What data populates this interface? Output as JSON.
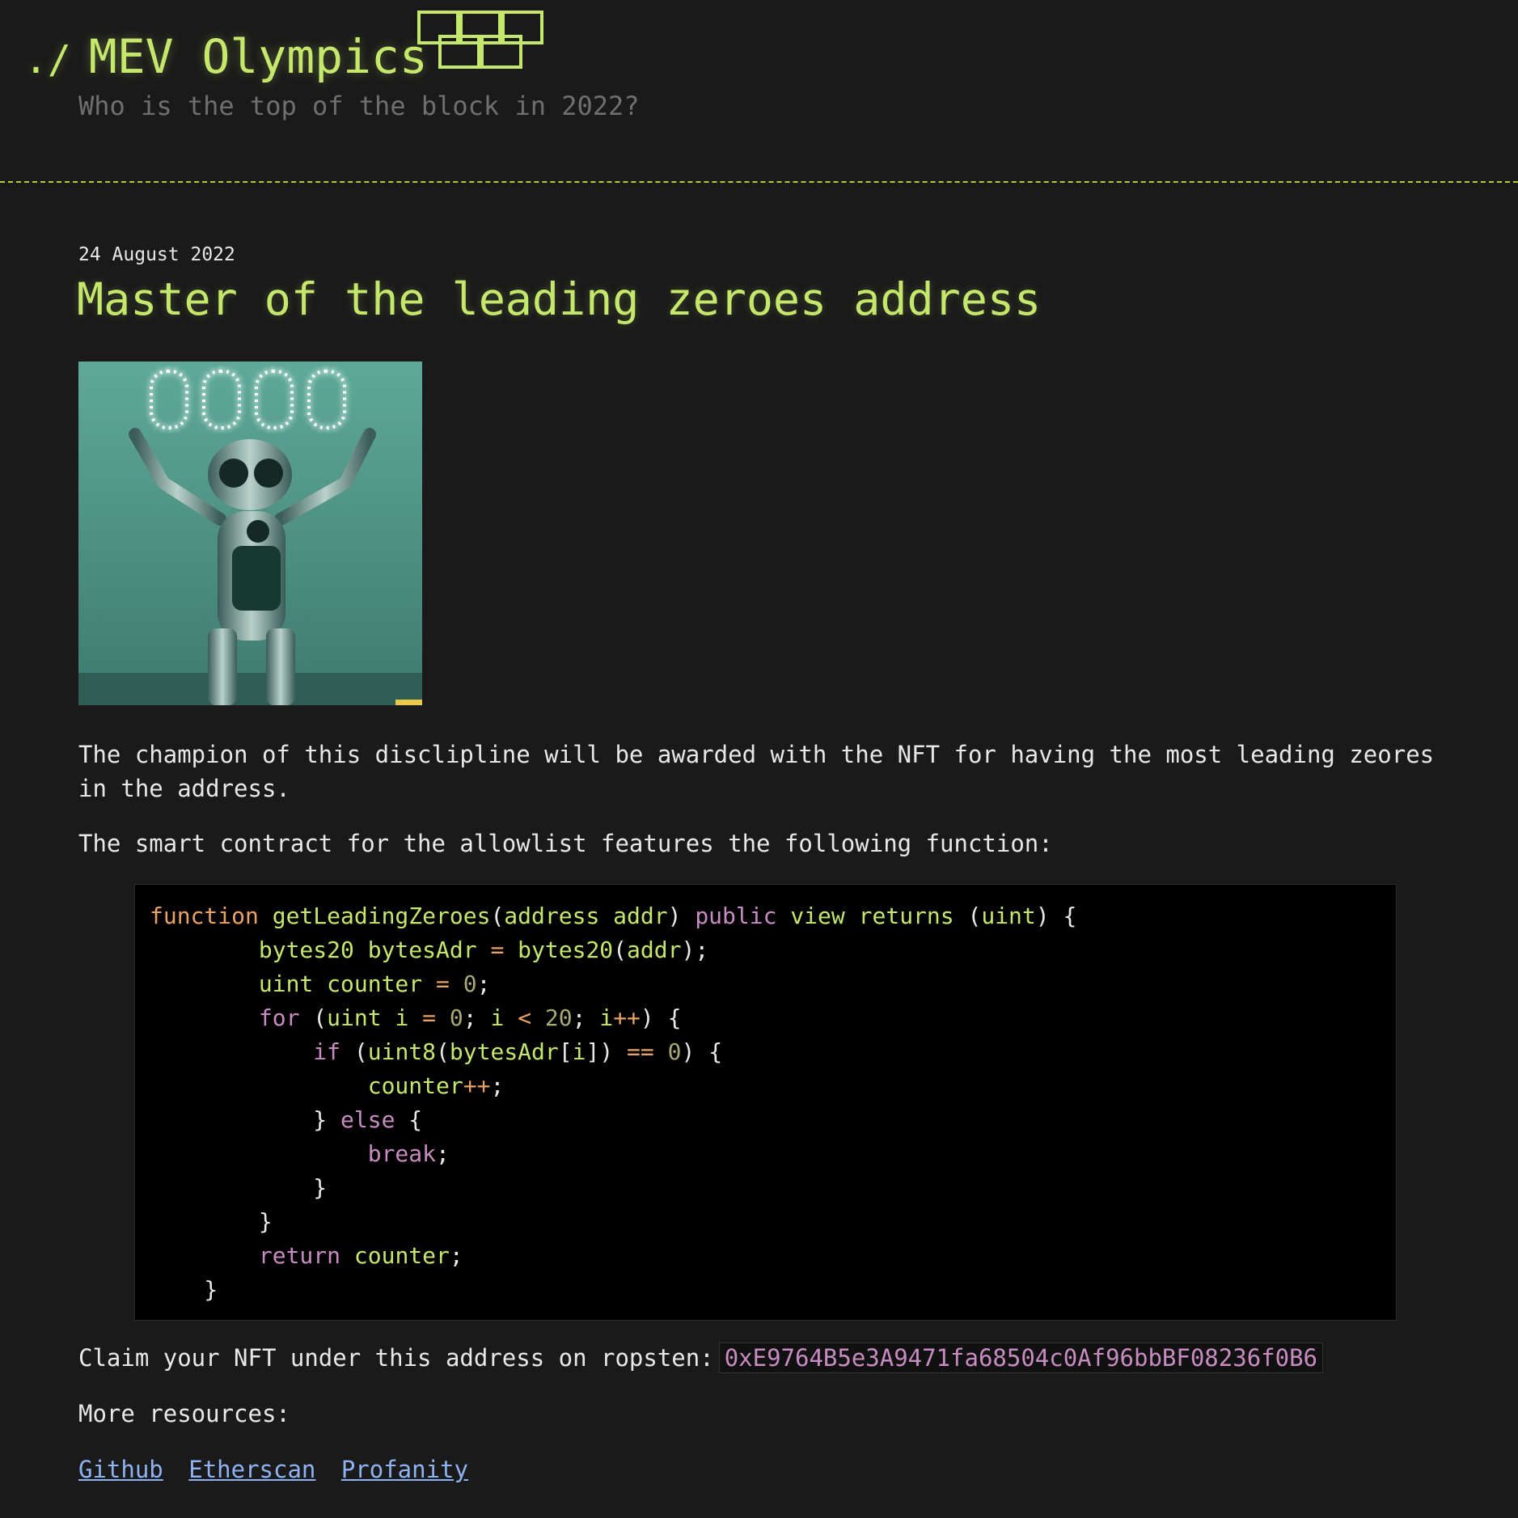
{
  "header": {
    "prompt": "./",
    "site_title": "MEV Olympics",
    "tagline": "Who is the top of the block in 2022?",
    "logo_icon": "olympic-rings-icon"
  },
  "post": {
    "date": "24 August 2022",
    "title": "Master of the leading zeroes address",
    "image_description_icon": "robot-zeroes-image",
    "paragraph_1": "The champion of this disclipline will be awarded with the NFT for having the most leading zeores in the address.",
    "paragraph_2": "The smart contract for the allowlist features the following function:",
    "code_lines": [
      [
        [
          "kw-fn",
          "function"
        ],
        [
          "t",
          " "
        ],
        [
          "id",
          "getLeadingZeroes"
        ],
        [
          "t",
          "("
        ],
        [
          "id",
          "address addr"
        ],
        [
          "t",
          ") "
        ],
        [
          "kw",
          "public"
        ],
        [
          "t",
          " "
        ],
        [
          "id",
          "view returns"
        ],
        [
          "t",
          " ("
        ],
        [
          "id",
          "uint"
        ],
        [
          "t",
          ") {"
        ]
      ],
      [
        [
          "t",
          "        "
        ],
        [
          "id",
          "bytes20 bytesAdr"
        ],
        [
          "t",
          " "
        ],
        [
          "op",
          "="
        ],
        [
          "t",
          " "
        ],
        [
          "id",
          "bytes20"
        ],
        [
          "t",
          "("
        ],
        [
          "id",
          "addr"
        ],
        [
          "t",
          ");"
        ]
      ],
      [
        [
          "t",
          "        "
        ],
        [
          "id",
          "uint counter"
        ],
        [
          "t",
          " "
        ],
        [
          "op",
          "="
        ],
        [
          "t",
          " "
        ],
        [
          "num",
          "0"
        ],
        [
          "t",
          ";"
        ]
      ],
      [
        [
          "t",
          "        "
        ],
        [
          "kw",
          "for"
        ],
        [
          "t",
          " ("
        ],
        [
          "id",
          "uint i"
        ],
        [
          "t",
          " "
        ],
        [
          "op",
          "="
        ],
        [
          "t",
          " "
        ],
        [
          "num",
          "0"
        ],
        [
          "t",
          "; "
        ],
        [
          "id",
          "i"
        ],
        [
          "t",
          " "
        ],
        [
          "op",
          "<"
        ],
        [
          "t",
          " "
        ],
        [
          "num",
          "20"
        ],
        [
          "t",
          "; "
        ],
        [
          "id",
          "i"
        ],
        [
          "op",
          "++"
        ],
        [
          "t",
          ") {"
        ]
      ],
      [
        [
          "t",
          "            "
        ],
        [
          "kw",
          "if"
        ],
        [
          "t",
          " ("
        ],
        [
          "id",
          "uint8"
        ],
        [
          "t",
          "("
        ],
        [
          "id",
          "bytesAdr"
        ],
        [
          "t",
          "["
        ],
        [
          "id",
          "i"
        ],
        [
          "t",
          "]) "
        ],
        [
          "op",
          "=="
        ],
        [
          "t",
          " "
        ],
        [
          "num",
          "0"
        ],
        [
          "t",
          ") {"
        ]
      ],
      [
        [
          "t",
          "                "
        ],
        [
          "id",
          "counter"
        ],
        [
          "op",
          "++"
        ],
        [
          "t",
          ";"
        ]
      ],
      [
        [
          "t",
          "            } "
        ],
        [
          "kw",
          "else"
        ],
        [
          "t",
          " {"
        ]
      ],
      [
        [
          "t",
          "                "
        ],
        [
          "kw",
          "break"
        ],
        [
          "t",
          ";"
        ]
      ],
      [
        [
          "t",
          "            }"
        ]
      ],
      [
        [
          "t",
          "        }"
        ]
      ],
      [
        [
          "t",
          "        "
        ],
        [
          "kw",
          "return"
        ],
        [
          "t",
          " "
        ],
        [
          "id",
          "counter"
        ],
        [
          "t",
          ";"
        ]
      ],
      [
        [
          "t",
          "    }"
        ]
      ]
    ],
    "claim_text": "Claim your NFT under this address on ropsten:",
    "contract_address": "0xE9764B5e3A9471fa68504c0Af96bbBF08236f0B6",
    "more_resources": "More resources:",
    "links": [
      "Github",
      "Etherscan",
      "Profanity"
    ]
  },
  "colors": {
    "background": "#1a1a1a",
    "accent_green": "#c5e86c",
    "muted": "#6f6f6f",
    "link": "#8fb3f2",
    "keyword_purple": "#c78cc2",
    "keyword_orange": "#e8a365"
  }
}
